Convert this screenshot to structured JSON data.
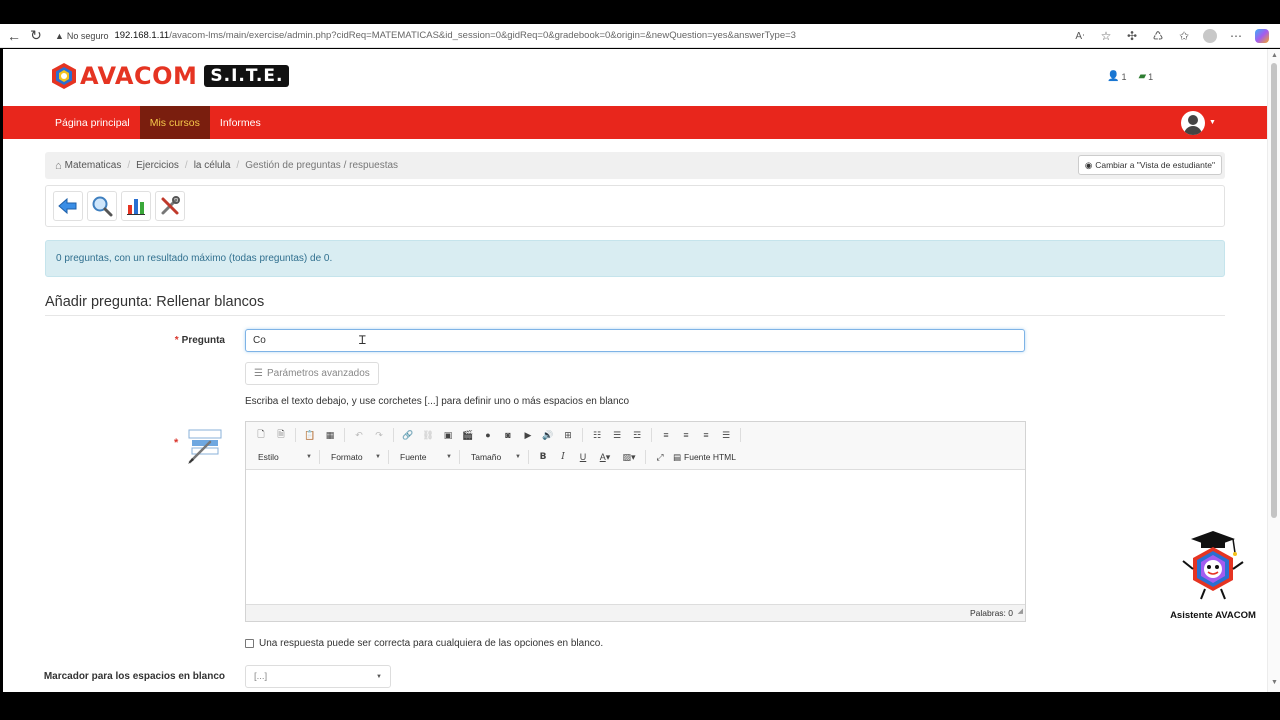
{
  "browser": {
    "not_secure_label": "No seguro",
    "url_host": "192.168.1.11",
    "url_path": "/avacom-lms/main/exercise/admin.php?cidReq=MATEMATICAS&id_session=0&gidReq=0&gradebook=0&origin=&newQuestion=yes&answerType=3"
  },
  "header": {
    "logo_text": "AVACOM",
    "logo_badge": "S.I.T.E.",
    "stats": {
      "users_count": "1",
      "board_count": "1"
    }
  },
  "nav": {
    "items": [
      {
        "label": "Página principal"
      },
      {
        "label": "Mis cursos"
      },
      {
        "label": "Informes"
      }
    ]
  },
  "breadcrumb": {
    "items": [
      "Matematicas",
      "Ejercicios",
      "la célula",
      "Gestión de preguntas / respuestas"
    ],
    "student_view_label": "Cambiar a \"Vista de estudiante\""
  },
  "alert": {
    "text": "0 preguntas, con un resultado máximo (todas preguntas) de 0."
  },
  "form": {
    "title": "Añadir pregunta: Rellenar blancos",
    "question_label": "Pregunta",
    "question_value": "Co",
    "advanced_label": "Parámetros avanzados",
    "help_text": "Escriba el texto debajo, y use corchetes [...] para definir uno o más espacios en blanco",
    "editor": {
      "style_label": "Estilo",
      "format_label": "Formato",
      "font_label": "Fuente",
      "size_label": "Tamaño",
      "source_label": "Fuente HTML",
      "words_label": "Palabras: 0"
    },
    "multiple_answers_label": "Una respuesta puede ser correcta para cualquiera de las opciones en blanco.",
    "marker_label": "Marcador para los espacios en blanco",
    "marker_value": "[...]"
  },
  "assistant": {
    "label": "Asistente AVACOM"
  },
  "colors": {
    "brand_red": "#e8261c",
    "nav_active": "#7a1e0e",
    "alert_bg": "#d9edf2"
  }
}
